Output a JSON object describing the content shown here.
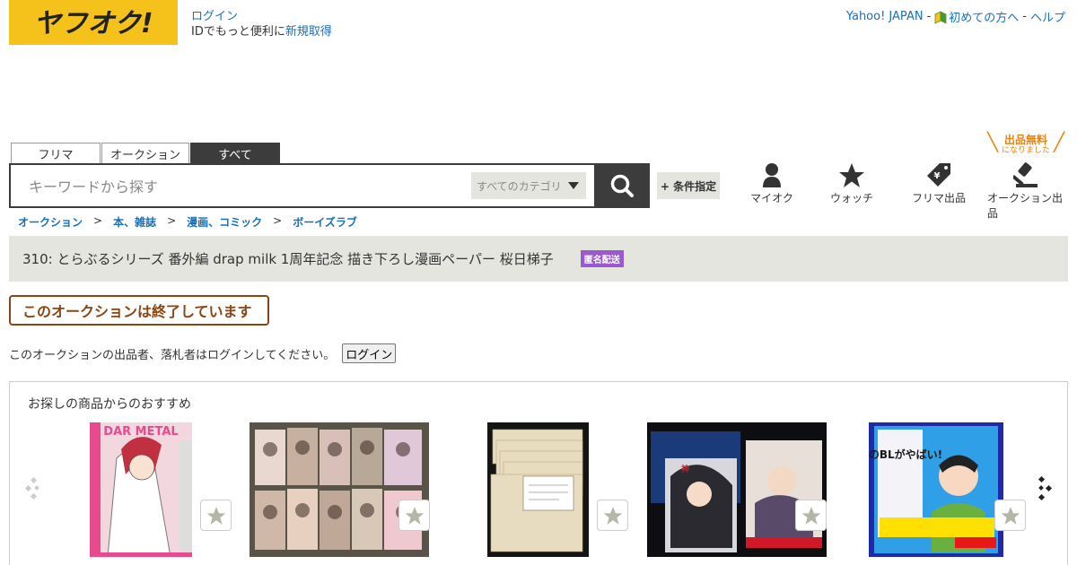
{
  "header": {
    "logo_text": "ヤフオク!",
    "login_link": "ログイン",
    "signup_prefix": "IDでもっと便利に",
    "signup_link": "新規取得",
    "top_links": [
      "Yahoo! JAPAN",
      "初めての方へ",
      "ヘルプ"
    ],
    "top_sep": "-"
  },
  "tabs": [
    {
      "label": "フリマ",
      "active": false
    },
    {
      "label": "オークション",
      "active": false
    },
    {
      "label": "すべて",
      "active": true
    }
  ],
  "search": {
    "placeholder": "キーワードから探す",
    "category": "すべてのカテゴリ",
    "advanced": "+ 条件指定",
    "icon": "search-icon"
  },
  "nav": [
    {
      "label": "マイオク",
      "icon": "person-icon"
    },
    {
      "label": "ウォッチ",
      "icon": "star-icon"
    },
    {
      "label": "フリマ出品",
      "icon": "yen-tag-icon"
    },
    {
      "label": "オークション出品",
      "icon": "gavel-icon"
    }
  ],
  "free_badge": {
    "main": "出品無料",
    "sub": "になりました"
  },
  "breadcrumb": [
    "オークション",
    "本、雑誌",
    "漫画、コミック",
    "ボーイズラブ"
  ],
  "breadcrumb_sep": ">",
  "item": {
    "title": "310: とらぶるシリーズ 番外編 drap milk 1周年記念 描き下ろし漫画ペーパー 桜日梯子",
    "badge": "匿名配送"
  },
  "ended_message": "このオークションは終了しています",
  "login_prompt": {
    "text": "このオークションの出品者、落札者はログインしてください。",
    "button": "ログイン"
  },
  "recommendations": {
    "title": "お探しの商品からのおすすめ",
    "items": [
      {
        "name": "rec-item-1",
        "alt": "DARK METAL comic cover",
        "cover_text": "DAR METAL"
      },
      {
        "name": "rec-item-2",
        "alt": "BL comic set"
      },
      {
        "name": "rec-item-3",
        "alt": "paper bundle"
      },
      {
        "name": "rec-item-4",
        "alt": "BL comic with booklet"
      },
      {
        "name": "rec-item-5",
        "alt": "このBLがやばい! 2015",
        "cover_text": "このBLがやばい!"
      }
    ]
  },
  "colors": {
    "brand_yellow": "#f5c11b",
    "dark": "#3c3c3c",
    "link": "#1a6fb5",
    "ended": "#8b4513",
    "free_orange": "#e8820c",
    "anon_purple": "#9b59d0"
  }
}
